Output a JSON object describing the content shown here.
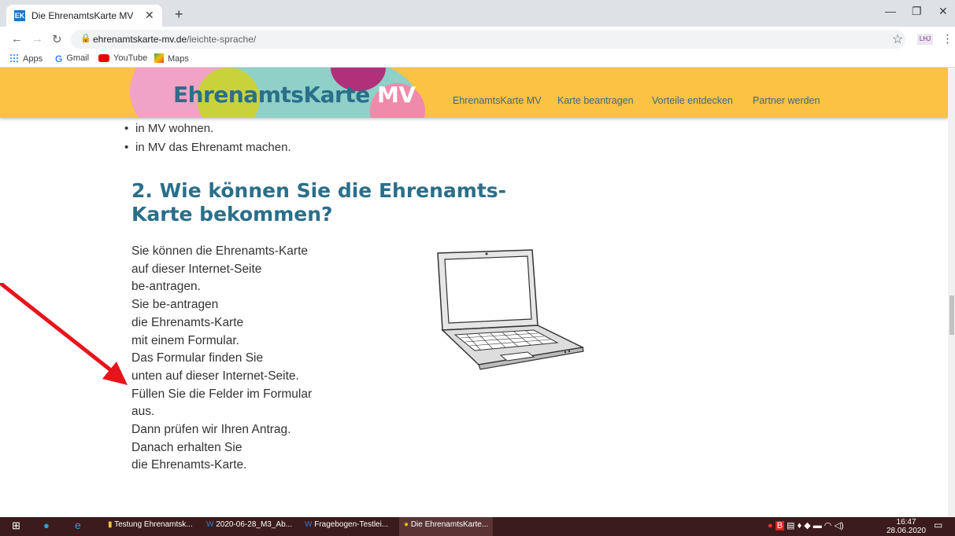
{
  "browser": {
    "tab_title": "Die EhrenamtsKarte MV",
    "tab_favicon": "EK",
    "url_domain": "ehrenamtskarte-mv.de",
    "url_path": "/leichte-sprache/",
    "bookmarks": [
      "Apps",
      "Gmail",
      "YouTube",
      "Maps"
    ]
  },
  "site": {
    "logo_part1": "Ehrenamts",
    "logo_part2": "Karte",
    "logo_part3": " MV",
    "nav": [
      "EhrenamtsKarte MV",
      "Karte beantragen",
      "Vorteile entdecken",
      "Partner werden"
    ]
  },
  "content": {
    "bullets": [
      "in MV wohnen.",
      "in MV das Ehrenamt machen."
    ],
    "heading": "2. Wie können Sie die Ehrenamts-Karte bekommen?",
    "paragraph_lines": [
      "Sie können die Ehrenamts-Karte",
      "auf dieser Internet-Seite",
      "be-antragen.",
      "Sie be-antragen",
      "die Ehrenamts-Karte",
      "mit einem Formular.",
      "Das Formular finden Sie",
      "unten auf dieser Internet-Seite.",
      "Füllen Sie die Felder im Formular",
      "aus.",
      "Dann prüfen wir Ihren Antrag.",
      "Danach erhalten Sie",
      "die Ehrenamts-Karte."
    ]
  },
  "taskbar": {
    "items": [
      "Testung Ehrenamtsk...",
      "2020-06-28_M3_Ab...",
      "Fragebogen-Testlei...",
      "Die EhrenamtsKarte..."
    ],
    "time": "16:47",
    "date": "28.06.2020"
  },
  "colors": {
    "header_yellow": "#fcc244",
    "heading_blue": "#2a6f8a",
    "arrow_red": "#e8141b"
  },
  "icons": [
    "back-icon",
    "forward-icon",
    "reload-icon",
    "lock-icon",
    "star-icon",
    "laptop-illustration",
    "red-arrow-annotation",
    "windows-start-icon"
  ]
}
